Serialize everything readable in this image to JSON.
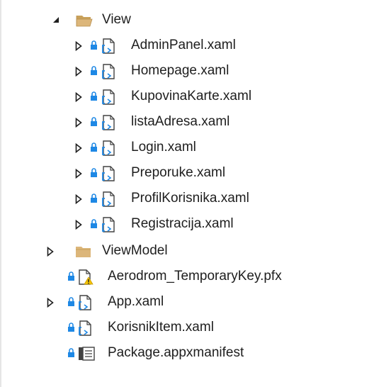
{
  "solution_explorer": {
    "items": [
      {
        "label": "View",
        "kind": "folder-open",
        "expander": "expanded"
      },
      {
        "label": "AdminPanel.xaml",
        "kind": "xaml",
        "expander": "collapsed"
      },
      {
        "label": "Homepage.xaml",
        "kind": "xaml",
        "expander": "collapsed"
      },
      {
        "label": "KupovinaKarte.xaml",
        "kind": "xaml",
        "expander": "collapsed"
      },
      {
        "label": "listaAdresa.xaml",
        "kind": "xaml",
        "expander": "collapsed"
      },
      {
        "label": "Login.xaml",
        "kind": "xaml",
        "expander": "collapsed"
      },
      {
        "label": "Preporuke.xaml",
        "kind": "xaml",
        "expander": "collapsed"
      },
      {
        "label": "ProfilKorisnika.xaml",
        "kind": "xaml",
        "expander": "collapsed"
      },
      {
        "label": "Registracija.xaml",
        "kind": "xaml",
        "expander": "collapsed"
      },
      {
        "label": "ViewModel",
        "kind": "folder",
        "expander": "collapsed"
      },
      {
        "label": "Aerodrom_TemporaryKey.pfx",
        "kind": "pfx-warning",
        "expander": "none"
      },
      {
        "label": "App.xaml",
        "kind": "xaml",
        "expander": "collapsed"
      },
      {
        "label": "KorisnikItem.xaml",
        "kind": "xaml",
        "expander": "none"
      },
      {
        "label": "Package.appxmanifest",
        "kind": "manifest",
        "expander": "none"
      }
    ]
  },
  "colors": {
    "lock": "#1e88e5",
    "folder": "#dcb67a",
    "file_outline": "#424242",
    "xaml_brackets": "#1e88e5",
    "warning": "#f5c400",
    "expander": "#1e1e1e"
  },
  "icons": {
    "expanded": "triangle-down-icon",
    "collapsed": "triangle-right-outline-icon",
    "lock": "padlock-icon",
    "folder": "folder-icon",
    "xaml": "xaml-file-icon",
    "warning": "warning-icon",
    "manifest": "manifest-file-icon"
  }
}
